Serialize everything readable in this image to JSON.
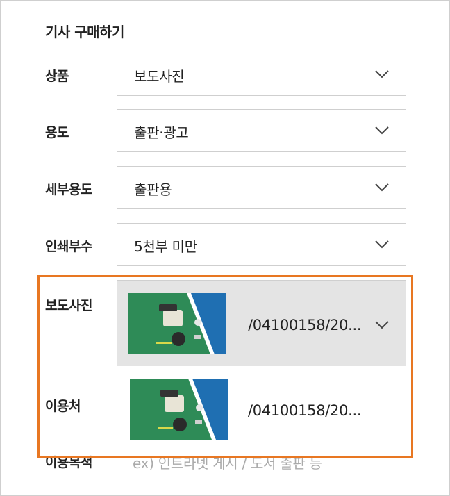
{
  "title": "기사 구매하기",
  "fields": {
    "product": {
      "label": "상품",
      "value": "보도사진"
    },
    "usage": {
      "label": "용도",
      "value": "출판·광고"
    },
    "detail_usage": {
      "label": "세부용도",
      "value": "출판용"
    },
    "print_count": {
      "label": "인쇄부수",
      "value": "5천부 미만"
    },
    "photo": {
      "label": "보도사진",
      "selected_text": "/04100158/20...",
      "option_text": "/04100158/20...",
      "thumbnail_icon": "photo-thumbnail"
    },
    "licensee": {
      "label": "이용처"
    },
    "purpose": {
      "label": "이용목적",
      "placeholder": "ex) 인트라넷 게시 / 도서 출판 등"
    }
  },
  "colors": {
    "highlight": "#e87722",
    "selected_bg": "#e4e4e4",
    "thumb_green": "#2e8b57",
    "thumb_blue": "#1f6fb2"
  }
}
